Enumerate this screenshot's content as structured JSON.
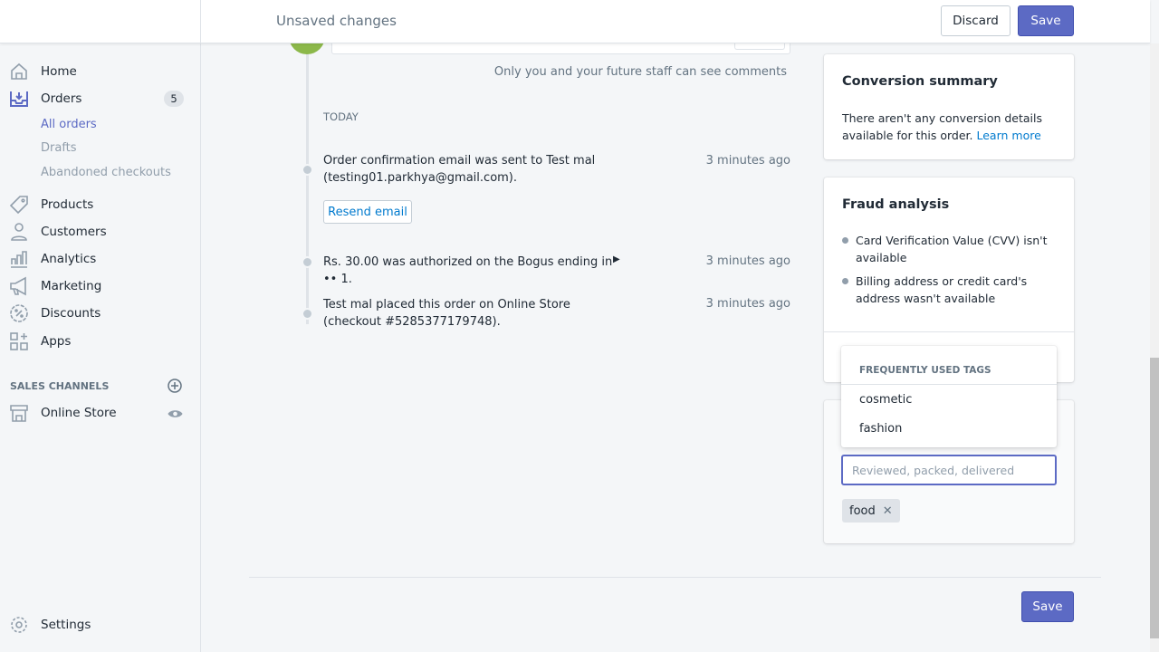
{
  "header": {
    "title": "Unsaved changes",
    "discard": "Discard",
    "save": "Save"
  },
  "sidebar": {
    "items": [
      {
        "label": "Home",
        "icon": "home-icon"
      },
      {
        "label": "Orders",
        "icon": "orders-icon",
        "badge": "5"
      },
      {
        "label": "Products",
        "icon": "tag-icon"
      },
      {
        "label": "Customers",
        "icon": "person-icon"
      },
      {
        "label": "Analytics",
        "icon": "bar-chart-icon"
      },
      {
        "label": "Marketing",
        "icon": "megaphone-icon"
      },
      {
        "label": "Discounts",
        "icon": "discount-icon"
      },
      {
        "label": "Apps",
        "icon": "apps-icon"
      }
    ],
    "orders_sub": [
      "All orders",
      "Drafts",
      "Abandoned checkouts"
    ],
    "sales_channels": "SALES CHANNELS",
    "online_store": "Online Store",
    "settings": "Settings",
    "accent": "#5c6ac4"
  },
  "timeline": {
    "note": "Only you and your future staff can see comments",
    "today": "TODAY",
    "events": [
      {
        "text": "Order confirmation email was sent to Test mal (testing01.parkhya@gmail.com).",
        "time": "3 minutes ago",
        "button": "Resend email"
      },
      {
        "text": "Rs. 30.00 was authorized on the Bogus ending in •• 1.",
        "time": "3 minutes ago"
      },
      {
        "text": "Test mal placed this order on Online Store (checkout #5285377179748).",
        "time": "3 minutes ago"
      }
    ]
  },
  "conversion": {
    "title": "Conversion summary",
    "text": "There aren't any conversion details available for this order.",
    "link": "Learn more"
  },
  "fraud": {
    "title": "Fraud analysis",
    "bullets": [
      "Card Verification Value (CVV) isn't available",
      "Billing address or credit card's address wasn't available"
    ]
  },
  "tags": {
    "dropdown_header": "FREQUENTLY USED TAGS",
    "options": [
      "cosmetic",
      "fashion"
    ],
    "placeholder": "Reviewed, packed, delivered",
    "applied": [
      "food"
    ]
  },
  "footer": {
    "save": "Save"
  }
}
